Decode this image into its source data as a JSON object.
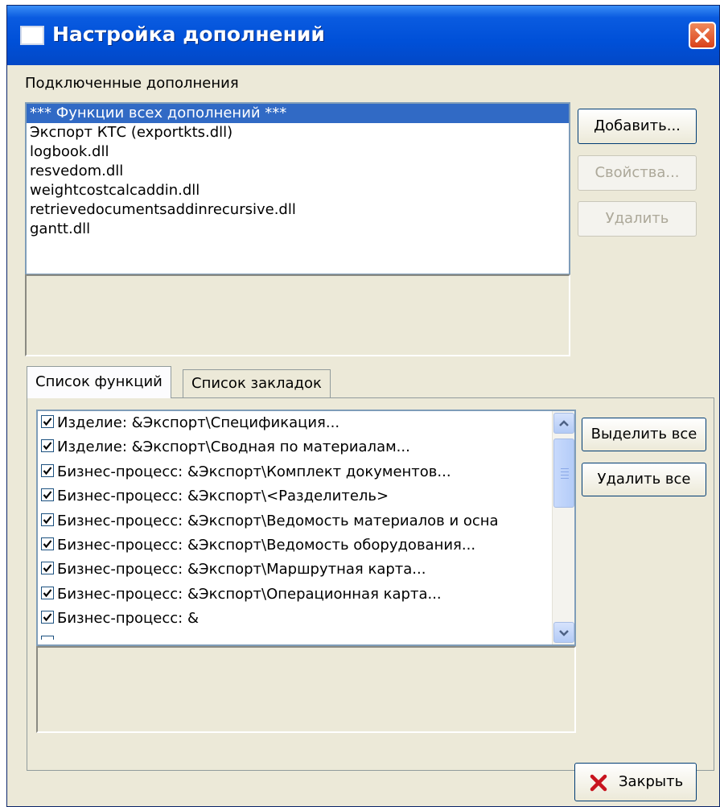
{
  "window": {
    "title": "Настройка дополнений"
  },
  "addins": {
    "label": "Подключенные дополнения",
    "items": [
      "*** Функции всех дополнений ***",
      "Экспорт КТС (exportkts.dll)",
      "logbook.dll",
      "resvedom.dll",
      "weightcostcalcaddin.dll",
      "retrievedocumentsaddinrecursive.dll",
      "gantt.dll"
    ],
    "selected_index": 0
  },
  "buttons": {
    "add": "Добавить...",
    "properties": "Свойства...",
    "delete": "Удалить",
    "select_all": "Выделить все",
    "delete_all": "Удалить все",
    "close": "Закрыть"
  },
  "tabs": [
    {
      "label": "Список функций",
      "active": true
    },
    {
      "label": "Список закладок",
      "active": false
    }
  ],
  "functions": [
    {
      "label": "Изделие: &Экспорт\\Спецификация...",
      "checked": true
    },
    {
      "label": "Изделие: &Экспорт\\Сводная по материалам...",
      "checked": true
    },
    {
      "label": "Бизнес-процесс: &Экспорт\\Комплект документов...",
      "checked": true
    },
    {
      "label": "Бизнес-процесс: &Экспорт\\<Разделитель>",
      "checked": true
    },
    {
      "label": "Бизнес-процесс: &Экспорт\\Ведомость материалов и осна",
      "checked": true
    },
    {
      "label": "Бизнес-процесс: &Экспорт\\Ведомость оборудования...",
      "checked": true
    },
    {
      "label": "Бизнес-процесс: &Экспорт\\Маршрутная карта...",
      "checked": true
    },
    {
      "label": "Бизнес-процесс: &Экспорт\\Операционная карта...",
      "checked": true
    },
    {
      "label": "Бизнес-процесс: &",
      "checked": true
    }
  ],
  "icons": {
    "title": "window-icon",
    "close": "close-x-icon",
    "close_button": "red-x-icon"
  },
  "colors": {
    "titlebar": "#0050D8",
    "selection": "#316AC5",
    "close_red": "#D9411A",
    "face": "#ECE9D8"
  }
}
